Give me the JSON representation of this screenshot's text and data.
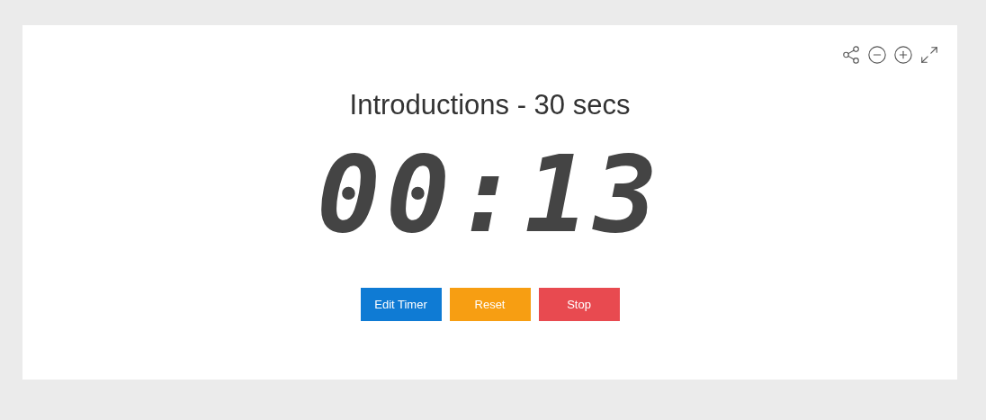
{
  "title": "Introductions - 30 secs",
  "time": "00:13",
  "buttons": [
    {
      "label": "Edit Timer",
      "color": "#0f7bd4"
    },
    {
      "label": "Reset",
      "color": "#f79e12"
    },
    {
      "label": "Stop",
      "color": "#e84a50"
    }
  ]
}
